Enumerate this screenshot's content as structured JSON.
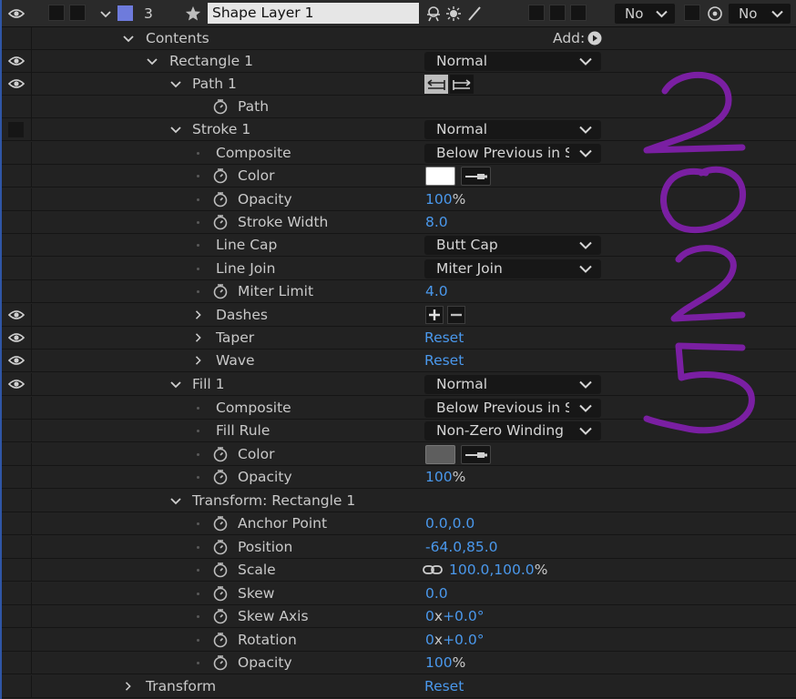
{
  "header": {
    "layer_number": "3",
    "layer_name": "Shape Layer 1",
    "mode_dropdown_1": "No",
    "mode_dropdown_2": "No",
    "label_color": "#6e7bdc"
  },
  "add": {
    "label": "Add:"
  },
  "rows": {
    "contents": "Contents",
    "rect1": "Rectangle 1",
    "rect1_mode": "Normal",
    "path1": "Path 1",
    "path": "Path",
    "stroke1": "Stroke 1",
    "stroke1_mode": "Normal",
    "stroke_composite": "Composite",
    "stroke_composite_val": "Below Previous in Same Group",
    "stroke_color": "Color",
    "stroke_color_hex": "#ffffff",
    "stroke_opacity": "Opacity",
    "stroke_opacity_val": "100",
    "stroke_width": "Stroke Width",
    "stroke_width_val": "8.0",
    "line_cap": "Line Cap",
    "line_cap_val": "Butt Cap",
    "line_join": "Line Join",
    "line_join_val": "Miter Join",
    "miter_limit": "Miter Limit",
    "miter_limit_val": "4.0",
    "dashes": "Dashes",
    "taper": "Taper",
    "taper_reset": "Reset",
    "wave": "Wave",
    "wave_reset": "Reset",
    "fill1": "Fill 1",
    "fill1_mode": "Normal",
    "fill_composite": "Composite",
    "fill_composite_val": "Below Previous in Same Group",
    "fill_rule": "Fill Rule",
    "fill_rule_val": "Non-Zero Winding",
    "fill_color": "Color",
    "fill_color_hex": "#5e5e5e",
    "fill_opacity": "Opacity",
    "fill_opacity_val": "100",
    "transform_rect": "Transform: Rectangle 1",
    "anchor": "Anchor Point",
    "anchor_val": "0.0,0.0",
    "position": "Position",
    "position_val": "-64.0,85.0",
    "scale": "Scale",
    "scale_val": "100.0,100.0",
    "skew": "Skew",
    "skew_val": "0.0",
    "skew_axis": "Skew Axis",
    "skew_axis_turns": "0",
    "skew_axis_deg": "+0.0°",
    "rotation": "Rotation",
    "rotation_turns": "0",
    "rotation_deg": "+0.0°",
    "opacity": "Opacity",
    "opacity_val": "100",
    "transform": "Transform",
    "transform_reset": "Reset"
  },
  "units": {
    "percent": "%",
    "turns_x": "x"
  },
  "annotation": {
    "handwritten": "2025",
    "color": "#7a1fa2"
  }
}
